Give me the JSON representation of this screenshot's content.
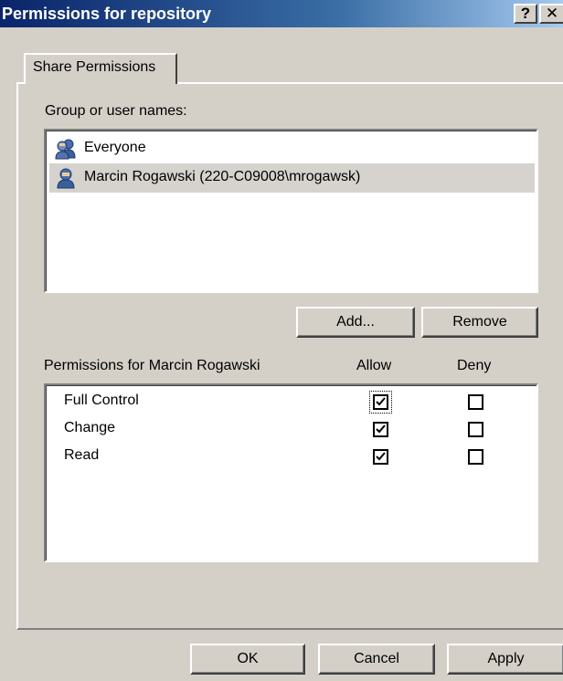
{
  "dialog": {
    "title": "Permissions for repository",
    "help_glyph": "?",
    "close_glyph": "✕"
  },
  "tab": {
    "label": "Share Permissions"
  },
  "users": {
    "label": "Group or user names:",
    "items": [
      {
        "name": "Everyone",
        "icon": "group-icon",
        "selected": false
      },
      {
        "name": "Marcin Rogawski (220-C09008\\mrogawsk)",
        "icon": "user-icon",
        "selected": true
      }
    ],
    "add_label": "Add...",
    "remove_label": "Remove"
  },
  "permissions": {
    "header_label": "Permissions for Marcin Rogawski",
    "allow_header": "Allow",
    "deny_header": "Deny",
    "rows": [
      {
        "name": "Full Control",
        "allow": true,
        "deny": false
      },
      {
        "name": "Change",
        "allow": true,
        "deny": false
      },
      {
        "name": "Read",
        "allow": true,
        "deny": false
      }
    ]
  },
  "footer": {
    "ok_label": "OK",
    "cancel_label": "Cancel",
    "apply_label": "Apply"
  }
}
